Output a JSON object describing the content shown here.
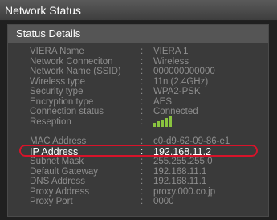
{
  "window": {
    "title": "Network Status"
  },
  "panel": {
    "title": "Status Details"
  },
  "colors": {
    "highlight": "#d8132a",
    "signal": "#8ac43f"
  },
  "separator": ":",
  "details": {
    "viera_name": {
      "label": "VIERA Name",
      "value": "VIERA 1"
    },
    "network_connection": {
      "label": "Network Conneciton",
      "value": "Wireless"
    },
    "ssid": {
      "label": "Network Name (SSID)",
      "value": "000000000000"
    },
    "wireless_type": {
      "label": "Wireless type",
      "value": "11n (2.4GHz)"
    },
    "security_type": {
      "label": "Security type",
      "value": "WPA2-PSK"
    },
    "encryption_type": {
      "label": "Encryption type",
      "value": "AES"
    },
    "connection_status": {
      "label": "Connection status",
      "value": "Connected"
    },
    "reception": {
      "label": "Reseption",
      "icon": "signal-strength-icon",
      "level": 1.0
    },
    "mac_address": {
      "label": "MAC Address",
      "value": "c0-d9-62-09-86-e1"
    },
    "ip_address": {
      "label": "IP Address",
      "value": "192.168.11.2"
    },
    "subnet_mask": {
      "label": "Subnet Mask",
      "value": "255.255.255.0"
    },
    "default_gateway": {
      "label": "Default Gateway",
      "value": "192.168.11.1"
    },
    "dns_address": {
      "label": "DNS Address",
      "value": "192.168.11.1"
    },
    "proxy_address": {
      "label": "Proxy Address",
      "value": "proxy.000.co.jp"
    },
    "proxy_port": {
      "label": "Proxy Port",
      "value": "0000"
    }
  }
}
